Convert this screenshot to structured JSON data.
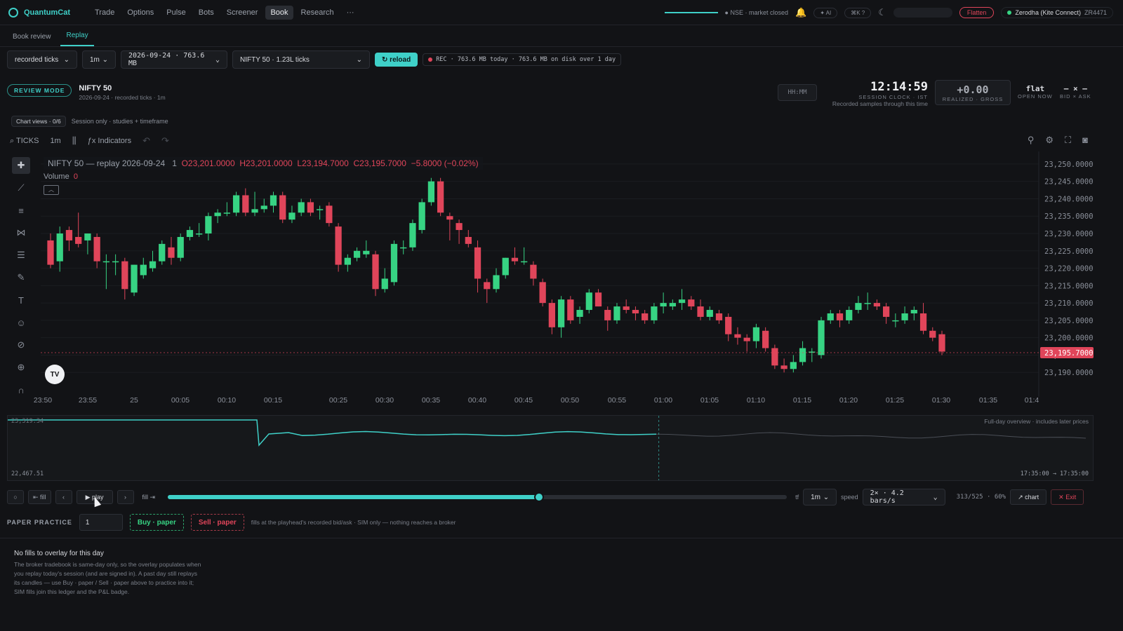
{
  "app": {
    "brand": "QuantumCat"
  },
  "nav": {
    "items": [
      "Trade",
      "Options",
      "Pulse",
      "Bots",
      "Screener",
      "Book",
      "Research",
      "···"
    ],
    "active": "Book"
  },
  "top": {
    "market": "● NSE · market closed",
    "ai": "✦ AI",
    "shortcut": "⌘K  ?",
    "flatten": "Flatten",
    "broker": "Zerodha (Kite Connect)",
    "account": "ZR4471"
  },
  "tabs": {
    "book_review": "Book review",
    "replay": "Replay"
  },
  "controls": {
    "source": "recorded ticks",
    "timeframe": "1m",
    "date": "2026-09-24 · 763.6 MB",
    "symbol": "NIFTY 50 · 1.23L ticks",
    "reload": "reload",
    "rec": "REC · 763.6 MB today · 763.6 MB on disk over 1 day"
  },
  "review": {
    "badge": "REVIEW MODE",
    "symbol": "NIFTY 50",
    "sub": "2026-09-24 · recorded ticks · 1m"
  },
  "clock": {
    "hhmm_placeholder": "HH:MM",
    "time": "12:14:59",
    "label": "SESSION CLOCK · IST",
    "sub": "Recorded samples through this time"
  },
  "pnl": {
    "value": "+0.00",
    "label": "REALIZED · GROSS"
  },
  "position": {
    "value": "flat",
    "label": "OPEN NOW",
    "bidask_value": "– × –",
    "bidask_label": "BID × ASK"
  },
  "views": {
    "chip": "Chart views · 0/6",
    "note": "Session only · studies + timeframe"
  },
  "chart_toolbar": {
    "symbol": "TICKS",
    "interval": "1m",
    "indicators": "Indicators"
  },
  "legend": {
    "title": "NIFTY 50 — replay 2026-09-24",
    "interval": "1",
    "o": "O23,201.0000",
    "h": "H23,201.0000",
    "l": "L23,194.7000",
    "c": "C23,195.7000",
    "chg": "−5.8000 (−0.02%)",
    "volume_label": "Volume",
    "volume_value": "0",
    "tv": "TV"
  },
  "chart_data": {
    "type": "candlestick",
    "ylim": [
      23185,
      23252
    ],
    "last_price": "23,195.7000",
    "y_ticks": [
      "23,250.0000",
      "23,245.0000",
      "23,240.0000",
      "23,235.0000",
      "23,230.0000",
      "23,225.0000",
      "23,220.0000",
      "23,215.0000",
      "23,210.0000",
      "23,205.0000",
      "23,200.0000",
      "23,195.0000",
      "23,190.0000"
    ],
    "x_ticks": [
      "23:50",
      "23:55",
      "25",
      "00:05",
      "00:10",
      "00:15",
      "00:25",
      "00:30",
      "00:35",
      "00:40",
      "00:45",
      "00:50",
      "00:55",
      "01:00",
      "01:05",
      "01:10",
      "01:15",
      "01:20",
      "01:25",
      "01:30",
      "01:35",
      "01:4"
    ],
    "candles": [
      {
        "o": 23228,
        "h": 23230,
        "l": 23220,
        "c": 23221
      },
      {
        "o": 23222,
        "h": 23232,
        "l": 23219,
        "c": 23230
      },
      {
        "o": 23231,
        "h": 23232,
        "l": 23225,
        "c": 23228
      },
      {
        "o": 23229,
        "h": 23236,
        "l": 23226,
        "c": 23227
      },
      {
        "o": 23228,
        "h": 23230,
        "l": 23224,
        "c": 23230
      },
      {
        "o": 23229,
        "h": 23230,
        "l": 23220,
        "c": 23222
      },
      {
        "o": 23222,
        "h": 23224,
        "l": 23214,
        "c": 23222
      },
      {
        "o": 23222,
        "h": 23224,
        "l": 23218,
        "c": 23222
      },
      {
        "o": 23222,
        "h": 23223,
        "l": 23211,
        "c": 23214
      },
      {
        "o": 23213,
        "h": 23221,
        "l": 23212,
        "c": 23221
      },
      {
        "o": 23218,
        "h": 23223,
        "l": 23217,
        "c": 23221
      },
      {
        "o": 23220,
        "h": 23225,
        "l": 23219,
        "c": 23222
      },
      {
        "o": 23222,
        "h": 23228,
        "l": 23221,
        "c": 23227
      },
      {
        "o": 23226,
        "h": 23229,
        "l": 23221,
        "c": 23223
      },
      {
        "o": 23223,
        "h": 23230,
        "l": 23222,
        "c": 23229
      },
      {
        "o": 23229,
        "h": 23232,
        "l": 23228,
        "c": 23231
      },
      {
        "o": 23230,
        "h": 23233,
        "l": 23229,
        "c": 23230
      },
      {
        "o": 23230,
        "h": 23236,
        "l": 23228,
        "c": 23235
      },
      {
        "o": 23235,
        "h": 23237,
        "l": 23233,
        "c": 23236
      },
      {
        "o": 23236,
        "h": 23239,
        "l": 23235,
        "c": 23236
      },
      {
        "o": 23236,
        "h": 23242,
        "l": 23235,
        "c": 23241
      },
      {
        "o": 23241,
        "h": 23243,
        "l": 23235,
        "c": 23236
      },
      {
        "o": 23236,
        "h": 23242,
        "l": 23235,
        "c": 23237
      },
      {
        "o": 23237,
        "h": 23240,
        "l": 23236,
        "c": 23238
      },
      {
        "o": 23238,
        "h": 23242,
        "l": 23236,
        "c": 23241
      },
      {
        "o": 23241,
        "h": 23242,
        "l": 23233,
        "c": 23234
      },
      {
        "o": 23234,
        "h": 23238,
        "l": 23233,
        "c": 23236
      },
      {
        "o": 23236,
        "h": 23240,
        "l": 23235,
        "c": 23239
      },
      {
        "o": 23239,
        "h": 23240,
        "l": 23235,
        "c": 23236
      },
      {
        "o": 23237,
        "h": 23238,
        "l": 23234,
        "c": 23237
      },
      {
        "o": 23238,
        "h": 23239,
        "l": 23232,
        "c": 23233
      },
      {
        "o": 23232,
        "h": 23233,
        "l": 23219,
        "c": 23221
      },
      {
        "o": 23221,
        "h": 23224,
        "l": 23219,
        "c": 23223
      },
      {
        "o": 23223,
        "h": 23226,
        "l": 23222,
        "c": 23225
      },
      {
        "o": 23224,
        "h": 23228,
        "l": 23223,
        "c": 23225
      },
      {
        "o": 23224,
        "h": 23225,
        "l": 23212,
        "c": 23214
      },
      {
        "o": 23214,
        "h": 23220,
        "l": 23213,
        "c": 23217
      },
      {
        "o": 23216,
        "h": 23228,
        "l": 23215,
        "c": 23227
      },
      {
        "o": 23226,
        "h": 23228,
        "l": 23224,
        "c": 23226
      },
      {
        "o": 23226,
        "h": 23234,
        "l": 23225,
        "c": 23233
      },
      {
        "o": 23231,
        "h": 23240,
        "l": 23230,
        "c": 23239
      },
      {
        "o": 23239,
        "h": 23246,
        "l": 23238,
        "c": 23245
      },
      {
        "o": 23245,
        "h": 23246,
        "l": 23235,
        "c": 23236
      },
      {
        "o": 23235,
        "h": 23236,
        "l": 23228,
        "c": 23234
      },
      {
        "o": 23233,
        "h": 23234,
        "l": 23227,
        "c": 23231
      },
      {
        "o": 23229,
        "h": 23231,
        "l": 23226,
        "c": 23227
      },
      {
        "o": 23226,
        "h": 23228,
        "l": 23213,
        "c": 23217
      },
      {
        "o": 23216,
        "h": 23217,
        "l": 23210,
        "c": 23214
      },
      {
        "o": 23214,
        "h": 23220,
        "l": 23213,
        "c": 23218
      },
      {
        "o": 23218,
        "h": 23223,
        "l": 23217,
        "c": 23223
      },
      {
        "o": 23223,
        "h": 23226,
        "l": 23221,
        "c": 23222
      },
      {
        "o": 23222,
        "h": 23226,
        "l": 23221,
        "c": 23222
      },
      {
        "o": 23221,
        "h": 23222,
        "l": 23215,
        "c": 23217
      },
      {
        "o": 23216,
        "h": 23217,
        "l": 23209,
        "c": 23210
      },
      {
        "o": 23210,
        "h": 23211,
        "l": 23201,
        "c": 23203
      },
      {
        "o": 23203,
        "h": 23212,
        "l": 23200,
        "c": 23211
      },
      {
        "o": 23211,
        "h": 23212,
        "l": 23204,
        "c": 23205
      },
      {
        "o": 23206,
        "h": 23209,
        "l": 23204,
        "c": 23208
      },
      {
        "o": 23208,
        "h": 23214,
        "l": 23207,
        "c": 23213
      },
      {
        "o": 23213,
        "h": 23214,
        "l": 23209,
        "c": 23209
      },
      {
        "o": 23208,
        "h": 23209,
        "l": 23202,
        "c": 23205
      },
      {
        "o": 23205,
        "h": 23210,
        "l": 23204,
        "c": 23209
      },
      {
        "o": 23209,
        "h": 23211,
        "l": 23207,
        "c": 23208
      },
      {
        "o": 23208,
        "h": 23209,
        "l": 23205,
        "c": 23207
      },
      {
        "o": 23207,
        "h": 23208,
        "l": 23204,
        "c": 23205
      },
      {
        "o": 23205,
        "h": 23210,
        "l": 23204,
        "c": 23209
      },
      {
        "o": 23209,
        "h": 23213,
        "l": 23207,
        "c": 23210
      },
      {
        "o": 23209,
        "h": 23211,
        "l": 23208,
        "c": 23210
      },
      {
        "o": 23210,
        "h": 23214,
        "l": 23208,
        "c": 23211
      },
      {
        "o": 23211,
        "h": 23212,
        "l": 23208,
        "c": 23209
      },
      {
        "o": 23209,
        "h": 23211,
        "l": 23205,
        "c": 23206
      },
      {
        "o": 23206,
        "h": 23209,
        "l": 23205,
        "c": 23208
      },
      {
        "o": 23207,
        "h": 23208,
        "l": 23204,
        "c": 23205
      },
      {
        "o": 23206,
        "h": 23207,
        "l": 23199,
        "c": 23201
      },
      {
        "o": 23201,
        "h": 23203,
        "l": 23198,
        "c": 23200
      },
      {
        "o": 23200,
        "h": 23201,
        "l": 23196,
        "c": 23199
      },
      {
        "o": 23199,
        "h": 23204,
        "l": 23197,
        "c": 23203
      },
      {
        "o": 23202,
        "h": 23203,
        "l": 23196,
        "c": 23197
      },
      {
        "o": 23197,
        "h": 23198,
        "l": 23191,
        "c": 23192
      },
      {
        "o": 23192,
        "h": 23194,
        "l": 23190,
        "c": 23191
      },
      {
        "o": 23191,
        "h": 23195,
        "l": 23190,
        "c": 23193
      },
      {
        "o": 23193,
        "h": 23199,
        "l": 23192,
        "c": 23197
      },
      {
        "o": 23196,
        "h": 23197,
        "l": 23193,
        "c": 23196
      },
      {
        "o": 23195,
        "h": 23206,
        "l": 23194,
        "c": 23205
      },
      {
        "o": 23205,
        "h": 23208,
        "l": 23204,
        "c": 23207
      },
      {
        "o": 23207,
        "h": 23208,
        "l": 23203,
        "c": 23205
      },
      {
        "o": 23205,
        "h": 23209,
        "l": 23204,
        "c": 23208
      },
      {
        "o": 23208,
        "h": 23212,
        "l": 23207,
        "c": 23210
      },
      {
        "o": 23210,
        "h": 23213,
        "l": 23208,
        "c": 23210
      },
      {
        "o": 23210,
        "h": 23211,
        "l": 23208,
        "c": 23209
      },
      {
        "o": 23209,
        "h": 23210,
        "l": 23204,
        "c": 23206
      },
      {
        "o": 23205,
        "h": 23207,
        "l": 23203,
        "c": 23205
      },
      {
        "o": 23205,
        "h": 23209,
        "l": 23204,
        "c": 23207
      },
      {
        "o": 23207,
        "h": 23209,
        "l": 23205,
        "c": 23208
      },
      {
        "o": 23207,
        "h": 23210,
        "l": 23201,
        "c": 23202
      },
      {
        "o": 23202,
        "h": 23203,
        "l": 23199,
        "c": 23200
      },
      {
        "o": 23201,
        "h": 23202,
        "l": 23195,
        "c": 23196
      }
    ]
  },
  "overview": {
    "top_value": "23,319.34",
    "bottom_value": "22,467.51",
    "note": "Full-day overview · includes later prices",
    "range": "17:35:00 → 17:35:00",
    "played_fraction": 0.6
  },
  "playback": {
    "reset": "○",
    "fill_left": "⇤ fill",
    "prev": "‹",
    "play": "▶ play",
    "next": "›",
    "fill_right": "fill ⇥",
    "progress": 0.6,
    "tf_label": "tf",
    "tf": "1m",
    "speed_label": "speed",
    "speed": "2× · 4.2 bars/s",
    "count": "313/525 · 60%",
    "chart": "↗ chart",
    "exit": "✕ Exit"
  },
  "paper": {
    "label": "PAPER PRACTICE",
    "qty": "1",
    "buy": "Buy · paper",
    "sell": "Sell · paper",
    "note": "fills at the playhead's recorded bid/ask · SIM only — nothing reaches a broker"
  },
  "nofills": {
    "title": "No fills to overlay for this day",
    "body": "The broker tradebook is same-day only, so the overlay populates when you replay today's session (and are signed in). A past day still replays its candles — use Buy · paper / Sell · paper above to practice into it; SIM fills join this ledger and the P&L badge."
  },
  "colors": {
    "accent": "#3fd0c8",
    "up": "#37d383",
    "down": "#e0455a",
    "bg": "#121316"
  }
}
